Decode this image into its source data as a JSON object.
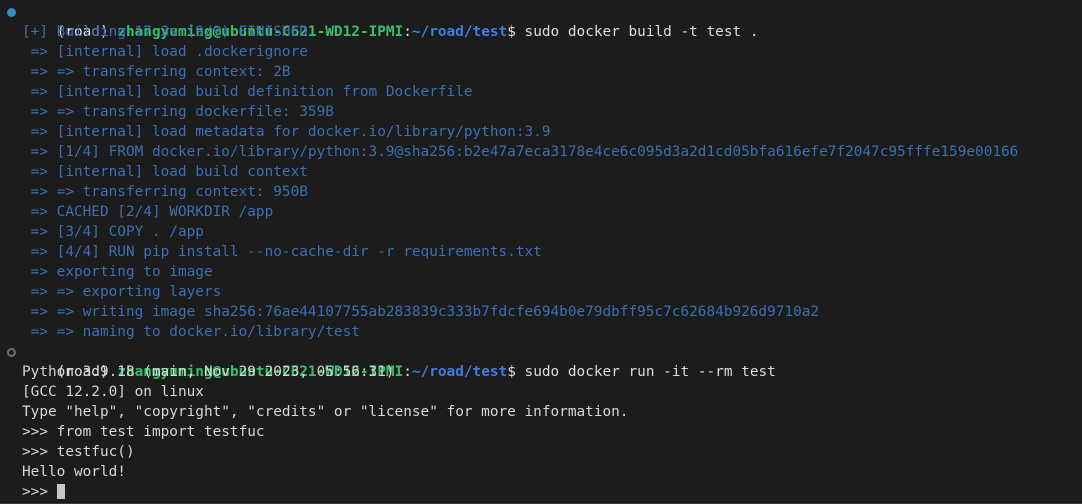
{
  "terminal": {
    "background_color": "#1c1c1c",
    "colors": {
      "docker_output": "#3c6fb5",
      "prompt_user_host": "#34c26d",
      "prompt_path": "#3d7fe0",
      "default_text": "#d6d6d6",
      "marker_active": "#2b8fc4",
      "marker_idle": "#6e6e6e"
    },
    "prompt": {
      "env": "(road)",
      "user_host": "zhangyuming@ubuntu-C621-WD12-IPMI",
      "colon": ":",
      "path": "~/road/test",
      "sigil": "$"
    },
    "commands": {
      "build": " sudo docker build -t test .",
      "run": " sudo docker run -it --rm test"
    },
    "build_output": [
      "[+] Building 17.3s (9/9) FINISHED",
      " => [internal] load .dockerignore",
      " => => transferring context: 2B",
      " => [internal] load build definition from Dockerfile",
      " => => transferring dockerfile: 359B",
      " => [internal] load metadata for docker.io/library/python:3.9",
      " => [1/4] FROM docker.io/library/python:3.9@sha256:b2e47a7eca3178e4ce6c095d3a2d1cd05bfa616efe7f2047c95fffe159e00166",
      " => [internal] load build context",
      " => => transferring context: 950B",
      " => CACHED [2/4] WORKDIR /app",
      " => [3/4] COPY . /app",
      " => [4/4] RUN pip install --no-cache-dir -r requirements.txt",
      " => exporting to image",
      " => => exporting layers",
      " => => writing image sha256:76ae44107755ab283839c333b7fdcfe694b0e79dbff95c7c62684b926d9710a2",
      " => => naming to docker.io/library/test"
    ],
    "python_session": {
      "banner_line_1": "Python 3.9.18 (main, Nov 29 2023, 05:56:31)",
      "banner_line_2": "[GCC 12.2.0] on linux",
      "banner_line_3": "Type \"help\", \"copyright\", \"credits\" or \"license\" for more information.",
      "prompt_symbol": ">>> ",
      "input_1": "from test import testfuc",
      "input_2": "testfuc()",
      "output_1": "Hello world!",
      "prompt_final": ">>> "
    }
  }
}
